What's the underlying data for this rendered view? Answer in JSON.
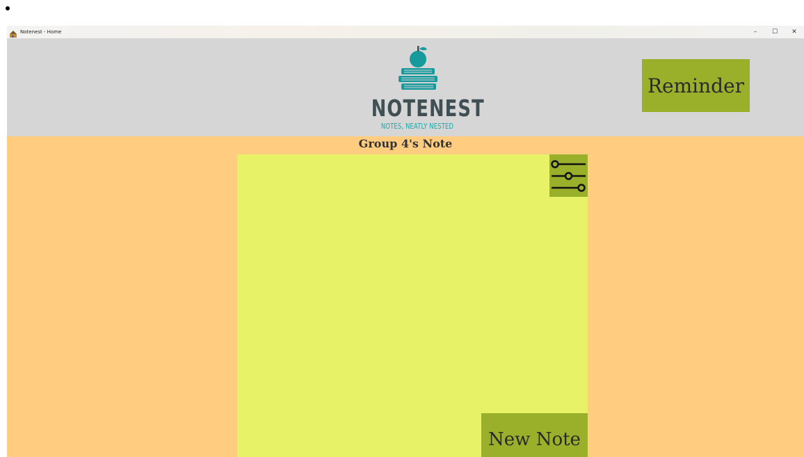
{
  "window": {
    "title": "Notenest - Home",
    "controls": {
      "minimize": "–",
      "maximize": "☐",
      "close": "✕"
    }
  },
  "header": {
    "logo": {
      "name": "NOTENEST",
      "tagline": "NOTES, NEATLY NESTED"
    },
    "reminder_label": "Reminder"
  },
  "main": {
    "group_title": "Group 4's Note",
    "new_note_label": "New Note"
  },
  "colors": {
    "background": "#ffcc80",
    "header": "#d6d6d6",
    "button": "#9aaf2a",
    "note_area": "#e8f266",
    "logo_teal": "#1ba6a8",
    "logo_dark": "#3f4f54"
  },
  "icons": {
    "settings": "sliders-icon",
    "logo": "books-apple-logo-icon",
    "app": "app-icon"
  }
}
